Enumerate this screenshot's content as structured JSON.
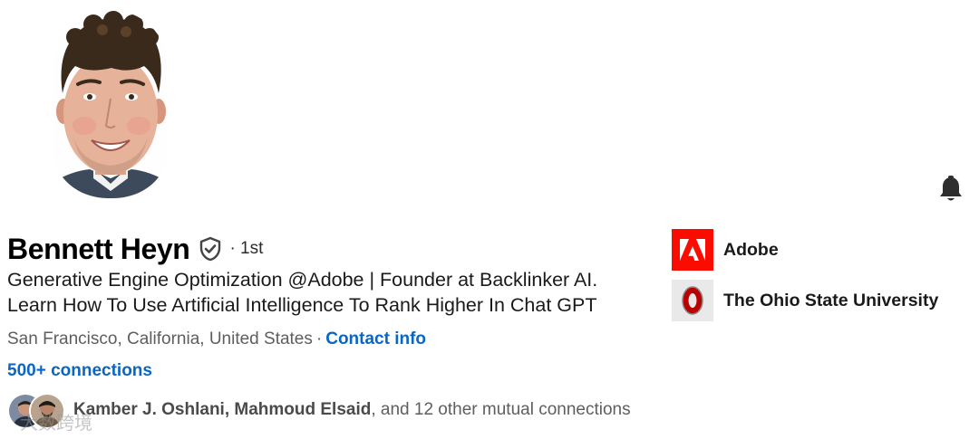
{
  "profile": {
    "name": "Bennett Heyn",
    "degree": "· 1st",
    "headline_line1": "Generative Engine Optimization @Adobe | Founder at Backlinker AI.",
    "headline_line2": "Learn How To Use Artificial Intelligence To Rank Higher In Chat GPT",
    "location": "San Francisco, California, United States",
    "separator": "·",
    "contact_info_label": "Contact info",
    "connections_label": "500+ connections"
  },
  "mutual": {
    "names": "Kamber J. Oshlani, Mahmoud Elsaid",
    "suffix": ", and 12 other mutual connections"
  },
  "organizations": [
    {
      "name": "Adobe",
      "logo": "adobe-logo"
    },
    {
      "name": "The Ohio State University",
      "logo": "ohio-state-logo"
    }
  ],
  "icons": {
    "verified": "verified-shield-icon",
    "notification": "bell-icon"
  },
  "colors": {
    "link": "#0a66c2",
    "adobe_red": "#fa0c00",
    "osu_scarlet": "#bb0000"
  },
  "watermark": "大数跨境"
}
